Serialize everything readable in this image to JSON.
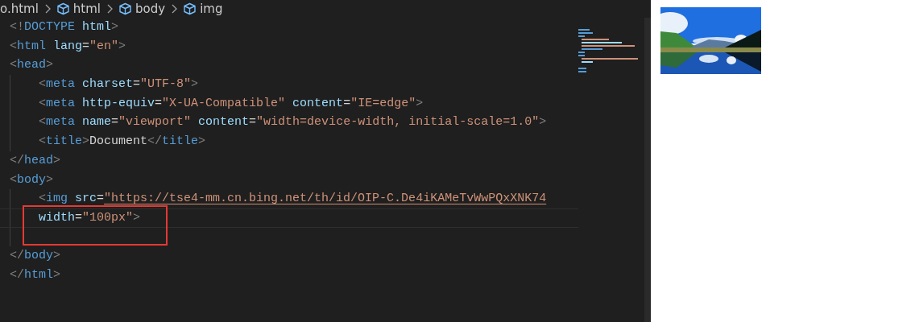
{
  "breadcrumbs": [
    {
      "label": "o.html",
      "icon": false
    },
    {
      "label": "html",
      "icon": true
    },
    {
      "label": "body",
      "icon": true
    },
    {
      "label": "img",
      "icon": true
    }
  ],
  "lines": [
    {
      "indented": false,
      "current": false,
      "boxed": false,
      "tokens": [
        {
          "kind": "punct",
          "text": "<!"
        },
        {
          "kind": "tag",
          "text": "DOCTYPE"
        },
        {
          "kind": "attr",
          "text": " html"
        },
        {
          "kind": "punct",
          "text": ">"
        }
      ]
    },
    {
      "indented": false,
      "current": false,
      "boxed": false,
      "tokens": [
        {
          "kind": "punct",
          "text": "<"
        },
        {
          "kind": "tag",
          "text": "html"
        },
        {
          "kind": "attr",
          "text": " lang"
        },
        {
          "kind": "plain",
          "text": "="
        },
        {
          "kind": "string",
          "text": "\"en\""
        },
        {
          "kind": "punct",
          "text": ">"
        }
      ]
    },
    {
      "indented": false,
      "current": false,
      "boxed": false,
      "tokens": [
        {
          "kind": "punct",
          "text": "<"
        },
        {
          "kind": "tag",
          "text": "head"
        },
        {
          "kind": "punct",
          "text": ">"
        }
      ]
    },
    {
      "indented": true,
      "current": false,
      "boxed": false,
      "tokens": [
        {
          "kind": "punct",
          "text": "<"
        },
        {
          "kind": "tag",
          "text": "meta"
        },
        {
          "kind": "attr",
          "text": " charset"
        },
        {
          "kind": "plain",
          "text": "="
        },
        {
          "kind": "string",
          "text": "\"UTF-8\""
        },
        {
          "kind": "punct",
          "text": ">"
        }
      ]
    },
    {
      "indented": true,
      "current": false,
      "boxed": false,
      "tokens": [
        {
          "kind": "punct",
          "text": "<"
        },
        {
          "kind": "tag",
          "text": "meta"
        },
        {
          "kind": "attr",
          "text": " http-equiv"
        },
        {
          "kind": "plain",
          "text": "="
        },
        {
          "kind": "string",
          "text": "\"X-UA-Compatible\""
        },
        {
          "kind": "attr",
          "text": " content"
        },
        {
          "kind": "plain",
          "text": "="
        },
        {
          "kind": "string",
          "text": "\"IE=edge\""
        },
        {
          "kind": "punct",
          "text": ">"
        }
      ]
    },
    {
      "indented": true,
      "current": false,
      "boxed": false,
      "tokens": [
        {
          "kind": "punct",
          "text": "<"
        },
        {
          "kind": "tag",
          "text": "meta"
        },
        {
          "kind": "attr",
          "text": " name"
        },
        {
          "kind": "plain",
          "text": "="
        },
        {
          "kind": "string",
          "text": "\"viewport\""
        },
        {
          "kind": "attr",
          "text": " content"
        },
        {
          "kind": "plain",
          "text": "="
        },
        {
          "kind": "string",
          "text": "\"width=device-width, initial-scale=1.0\""
        },
        {
          "kind": "punct",
          "text": ">"
        }
      ]
    },
    {
      "indented": true,
      "current": false,
      "boxed": false,
      "tokens": [
        {
          "kind": "punct",
          "text": "<"
        },
        {
          "kind": "tag",
          "text": "title"
        },
        {
          "kind": "punct",
          "text": ">"
        },
        {
          "kind": "plain",
          "text": "Document"
        },
        {
          "kind": "punct",
          "text": "</"
        },
        {
          "kind": "tag",
          "text": "title"
        },
        {
          "kind": "punct",
          "text": ">"
        }
      ]
    },
    {
      "indented": false,
      "current": false,
      "boxed": false,
      "tokens": [
        {
          "kind": "punct",
          "text": "</"
        },
        {
          "kind": "tag",
          "text": "head"
        },
        {
          "kind": "punct",
          "text": ">"
        }
      ]
    },
    {
      "indented": false,
      "current": false,
      "boxed": false,
      "tokens": [
        {
          "kind": "punct",
          "text": "<"
        },
        {
          "kind": "tag",
          "text": "body"
        },
        {
          "kind": "punct",
          "text": ">"
        }
      ]
    },
    {
      "indented": true,
      "current": false,
      "boxed": false,
      "tokens": [
        {
          "kind": "punct",
          "text": "<"
        },
        {
          "kind": "tag",
          "text": "img"
        },
        {
          "kind": "attr",
          "text": " src"
        },
        {
          "kind": "plain",
          "text": "="
        },
        {
          "kind": "url",
          "text": "\"https://tse4-mm.cn.bing.net/th/id/OIP-C.De4iKAMeTvWwPQxXNK74"
        }
      ]
    },
    {
      "indented": true,
      "current": true,
      "boxed": true,
      "tokens": [
        {
          "kind": "attr",
          "text": "width"
        },
        {
          "kind": "plain",
          "text": "="
        },
        {
          "kind": "string",
          "text": "\"100px\""
        },
        {
          "kind": "punct",
          "text": ">"
        }
      ]
    },
    {
      "indented": true,
      "current": false,
      "boxed": false
    },
    {
      "indented": false,
      "current": false,
      "boxed": false,
      "tokens": [
        {
          "kind": "punct",
          "text": "</"
        },
        {
          "kind": "tag",
          "text": "body"
        },
        {
          "kind": "punct",
          "text": ">"
        }
      ]
    },
    {
      "indented": false,
      "current": false,
      "boxed": false,
      "tokens": [
        {
          "kind": "punct",
          "text": "</"
        },
        {
          "kind": "tag",
          "text": "html"
        },
        {
          "kind": "punct",
          "text": ">"
        }
      ]
    }
  ]
}
